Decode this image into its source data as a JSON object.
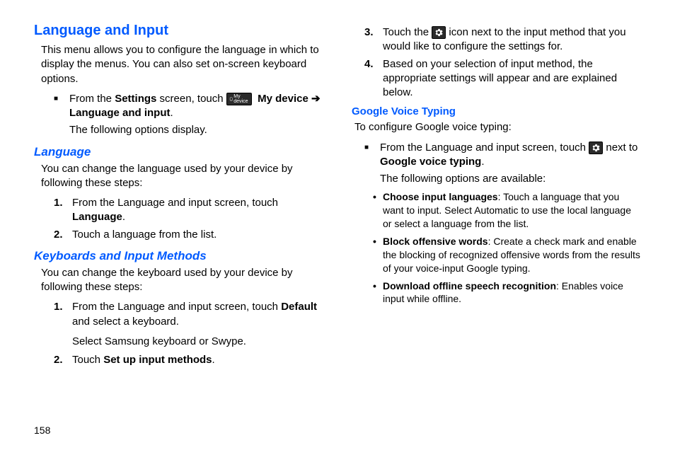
{
  "page_number": "158",
  "left": {
    "h1": "Language and Input",
    "intro": "This menu allows you to configure the language in which to display the menus. You can also set on-screen keyboard options.",
    "from_settings_pre": "From the ",
    "from_settings_bold1": "Settings",
    "from_settings_mid": " screen, touch ",
    "icon_mydevice": "My device",
    "from_settings_bold2": "My device",
    "arrow": "➔",
    "from_settings_bold3": "Language and input",
    "from_settings_post": ".",
    "following_display": "The following options display.",
    "h2_language": "Language",
    "language_intro": "You can change the language used by your device by following these steps:",
    "lang_steps": [
      {
        "n": "1.",
        "pre": "From the Language and input screen, touch ",
        "b": "Language",
        "post": "."
      },
      {
        "n": "2.",
        "pre": "Touch a language from the list.",
        "b": "",
        "post": ""
      }
    ],
    "h2_keyboards": "Keyboards and Input Methods",
    "kb_intro": "You can change the keyboard used by your device by following these steps:",
    "kb_steps": [
      {
        "n": "1.",
        "pre": "From the Language and input screen, touch ",
        "b": "Default",
        "post": " and select a keyboard."
      },
      {
        "n": "2.",
        "pre": "Touch ",
        "b": "Set up input methods",
        "post": "."
      }
    ],
    "kb_sub": "Select Samsung keyboard or Swype."
  },
  "right": {
    "cont_steps": [
      {
        "n": "3.",
        "pre": "Touch the ",
        "icon": "gear",
        "post_pre": " icon next to the input method that you would like to configure the settings for."
      },
      {
        "n": "4.",
        "pre": "Based on your selection of input method, the appropriate settings will appear and are explained below.",
        "icon": "",
        "post_pre": ""
      }
    ],
    "h3_gvt": "Google Voice Typing",
    "gvt_intro": "To configure Google voice typing:",
    "gvt_bullet_pre": "From the Language and input screen, touch ",
    "gvt_bullet_post": " next to ",
    "gvt_bullet_bold": "Google voice typing",
    "gvt_bullet_end": ".",
    "gvt_following": "The following options are available:",
    "gvt_opts": [
      {
        "b": "Choose input languages",
        "t": ": Touch a language that you want to input. Select Automatic to use the local language or select a language from the list."
      },
      {
        "b": "Block offensive words",
        "t": ": Create a check mark and enable the blocking of recognized offensive words from the results of your voice-input Google typing."
      },
      {
        "b": "Download offline speech recognition",
        "t": ": Enables voice input while offline."
      }
    ]
  }
}
